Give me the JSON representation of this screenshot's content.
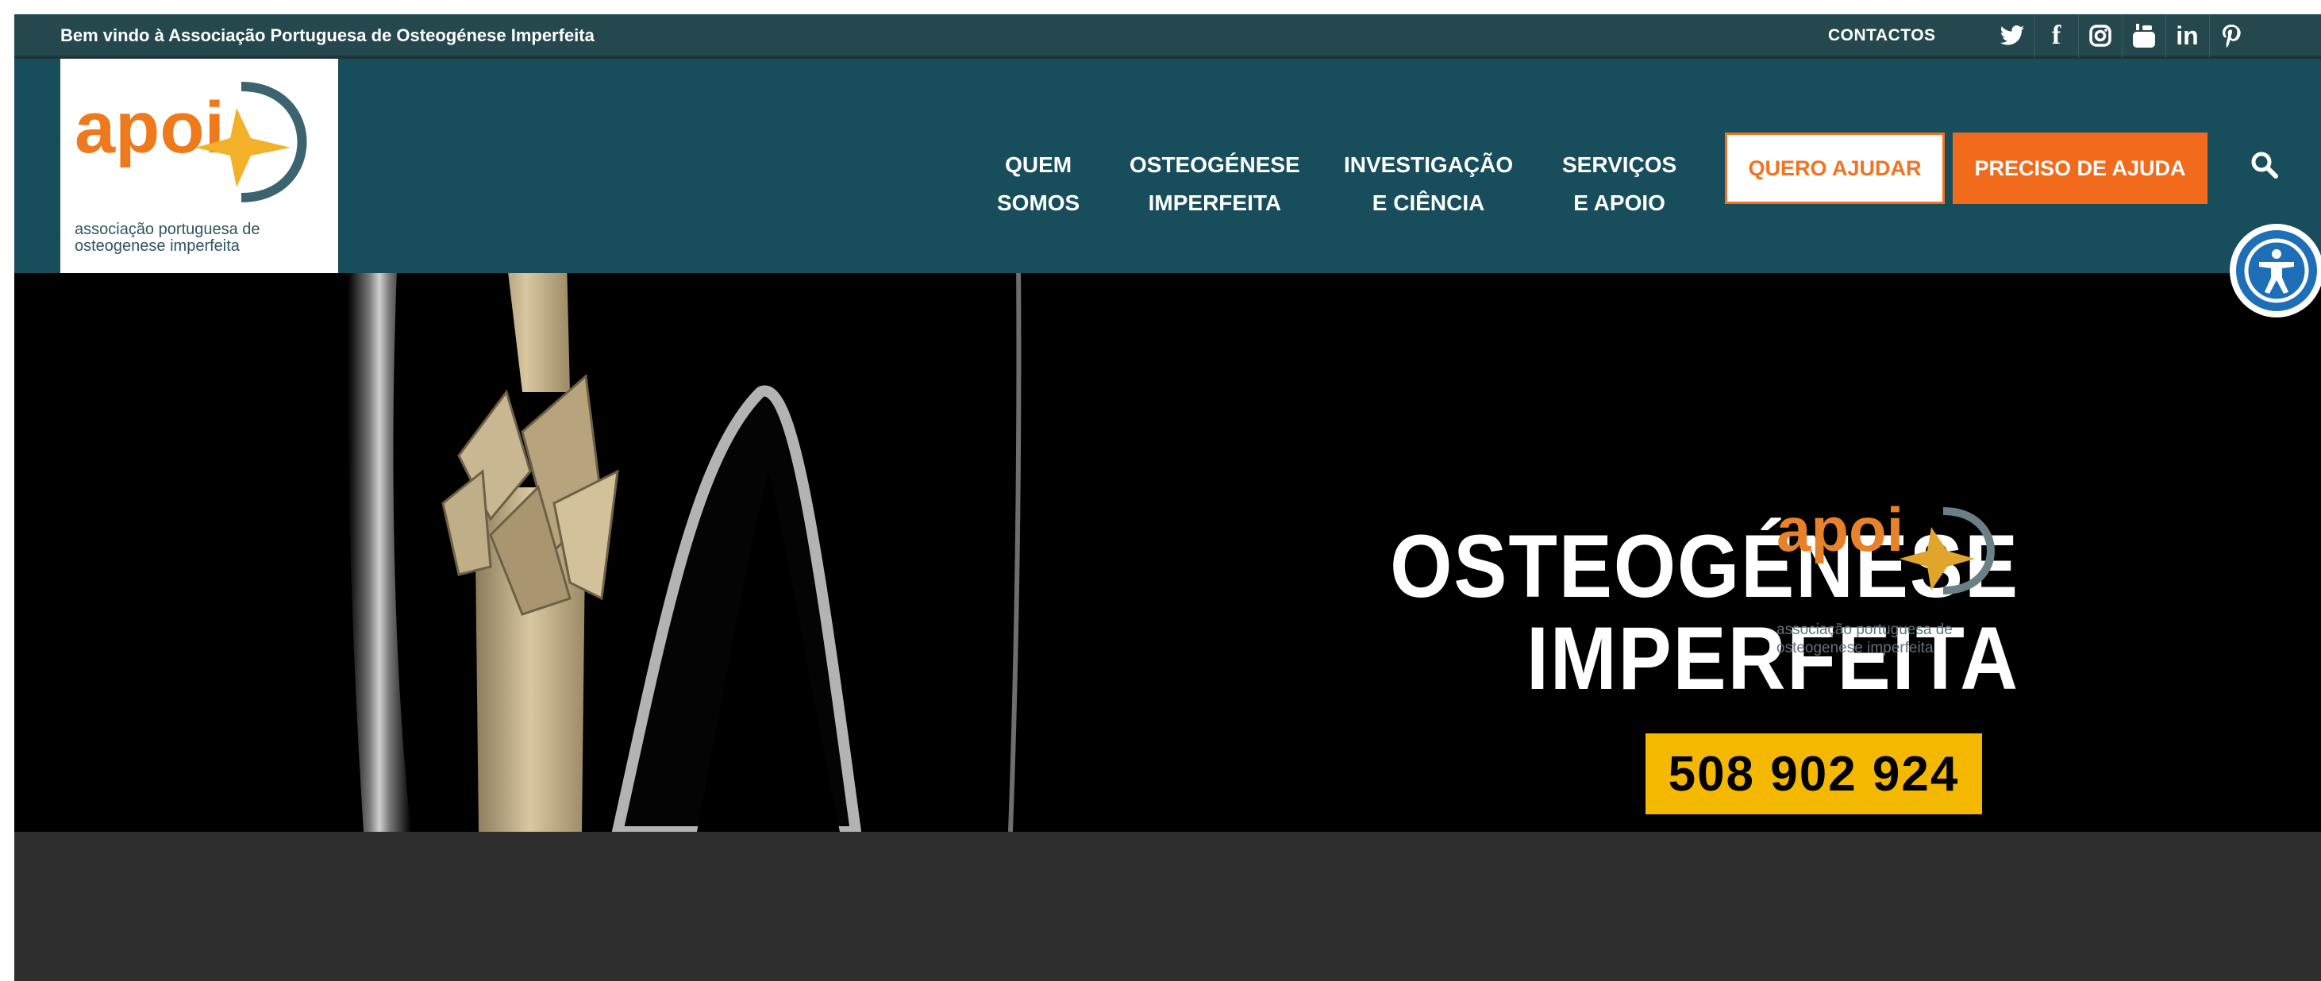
{
  "topbar": {
    "welcome": "Bem vindo à Associação Portuguesa de Osteogénese Imperfeita",
    "contacts": "CONTACTOS",
    "social": [
      {
        "icon": "twitter-icon",
        "glyph": "🐦"
      },
      {
        "icon": "facebook-icon",
        "glyph": "f"
      },
      {
        "icon": "instagram-icon",
        "glyph": "◎"
      },
      {
        "icon": "youtube-icon",
        "glyph": "▶"
      },
      {
        "icon": "linkedin-icon",
        "glyph": "in"
      },
      {
        "icon": "pinterest-icon",
        "glyph": "p"
      }
    ]
  },
  "logo": {
    "wordmark": "apoi",
    "caption_line1": "associação portuguesa de",
    "caption_line2": "osteogenese imperfeita"
  },
  "nav": {
    "items": [
      {
        "line1": "QUEM",
        "line2": "SOMOS"
      },
      {
        "line1": "OSTEOGÉNESE",
        "line2": "IMPERFEITA"
      },
      {
        "line1": "INVESTIGAÇÃO",
        "line2": "E CIÊNCIA"
      },
      {
        "line1": "SERVIÇOS",
        "line2": "E APOIO"
      }
    ],
    "quero_ajudar": "QUERO AJUDAR",
    "preciso_ajuda": "PRECISO DE AJUDA"
  },
  "hero": {
    "title_line1": "OSTEOGÉNESE",
    "title_line2": "IMPERFEITA",
    "phone": "508 902 924",
    "logo_caption_line1": "associação portuguesa de",
    "logo_caption_line2": "osteogenese imperfeita"
  },
  "colors": {
    "topbar": "#25484f",
    "header": "#184e5b",
    "accent_orange": "#f26a1b",
    "phone_yellow": "#f5b800",
    "a11y_blue": "#1e6fb8"
  }
}
